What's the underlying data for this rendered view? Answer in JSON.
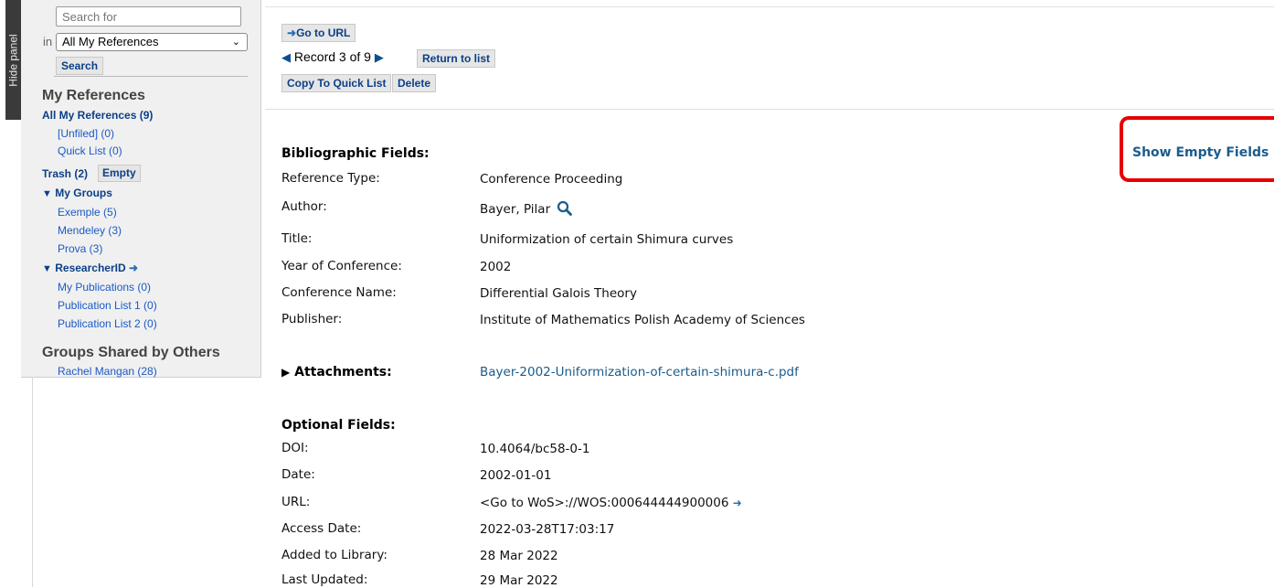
{
  "hide_panel": {
    "label": "Hide panel"
  },
  "search": {
    "placeholder": "Search for",
    "in_label": "in",
    "scope_selected": "All My References",
    "button_label": "Search"
  },
  "my_references": {
    "heading": "My References",
    "all": "All My References (9)",
    "unfiled": "[Unfiled] (0)",
    "quick_list": "Quick List (0)",
    "trash": "Trash (2)",
    "empty_button": "Empty"
  },
  "my_groups": {
    "heading": "My Groups",
    "items": [
      "Exemple (5)",
      "Mendeley (3)",
      "Prova (3)"
    ]
  },
  "researcher_id": {
    "heading": "ResearcherID",
    "items": [
      "My Publications (0)",
      "Publication List 1 (0)",
      "Publication List 2 (0)"
    ]
  },
  "shared": {
    "heading": "Groups Shared by Others",
    "items": [
      "Rachel Mangan (28)"
    ]
  },
  "toolbar": {
    "go_to_url": "Go to URL",
    "record_position": "Record 3 of 9",
    "return_to_list": "Return to list",
    "copy_to_quick_list": "Copy To Quick List",
    "delete": "Delete"
  },
  "bibliographic": {
    "heading": "Bibliographic Fields:",
    "show_empty": "Show Empty Fields",
    "fields": [
      {
        "label": "Reference Type:",
        "value": "Conference Proceeding"
      },
      {
        "label": "Author:",
        "value": "Bayer, Pilar"
      },
      {
        "label": "Title:",
        "value": "Uniformization of certain Shimura curves"
      },
      {
        "label": "Year of Conference:",
        "value": "2002"
      },
      {
        "label": "Conference Name:",
        "value": "Differential Galois Theory"
      },
      {
        "label": "Publisher:",
        "value": "Institute of Mathematics Polish Academy of Sciences"
      }
    ]
  },
  "attachments": {
    "label": "Attachments:",
    "file": "Bayer-2002-Uniformization-of-certain-shimura-c.pdf"
  },
  "optional": {
    "heading": "Optional Fields:",
    "fields": [
      {
        "label": "DOI:",
        "value": "10.4064/bc58-0-1"
      },
      {
        "label": "Date:",
        "value": "2002-01-01"
      },
      {
        "label": "URL:",
        "value": "<Go to WoS>://WOS:000644444900006"
      },
      {
        "label": "Access Date:",
        "value": "2022-03-28T17:03:17"
      },
      {
        "label": "Added to Library:",
        "value": "28 Mar 2022"
      },
      {
        "label": "Last Updated:",
        "value": "29 Mar 2022"
      }
    ]
  },
  "colors": {
    "link": "#1a5c8c",
    "highlight": "#e60000",
    "button_text": "#0b3f88"
  }
}
